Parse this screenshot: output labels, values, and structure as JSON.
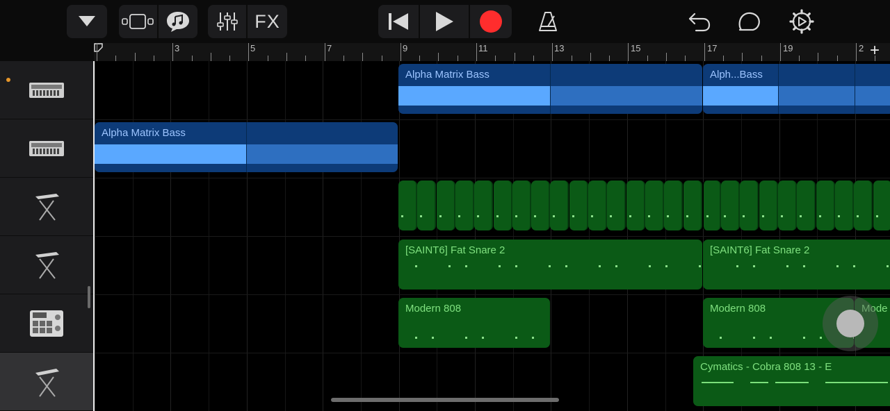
{
  "toolbar": {
    "fx_label": "FX",
    "icons": [
      "dropdown-triangle-icon",
      "tracks-view-icon",
      "live-loops-icon",
      "mixer-icon",
      "skip-back-icon",
      "play-icon",
      "record-icon",
      "metronome-icon",
      "undo-icon",
      "loop-browser-icon",
      "settings-icon"
    ],
    "record_color": "#ff2d2d"
  },
  "ruler": {
    "bar_numbers": [
      "3",
      "5",
      "7",
      "9",
      "11",
      "13",
      "15",
      "17",
      "19",
      "2"
    ],
    "add_label": "+"
  },
  "tracks": [
    {
      "instrument": "alpha-bass-synth-icon",
      "armed": true
    },
    {
      "instrument": "alpha-bass-synth-icon",
      "armed": false
    },
    {
      "instrument": "keyboard-stand-icon",
      "armed": false
    },
    {
      "instrument": "keyboard-stand-icon",
      "armed": false
    },
    {
      "instrument": "drum-machine-icon",
      "armed": false
    },
    {
      "instrument": "keyboard-stand-icon",
      "armed": false,
      "selected": true
    }
  ],
  "regions": {
    "r1": "Alpha Matrix Bass",
    "r2": "Alph...Bass",
    "r3": "Alpha Matrix Bass",
    "r4": "[SAINT6] Fat Snare 2",
    "r5": "[SAINT6] Fat Snare 2",
    "r6": "Modern 808",
    "r7": "Modern 808",
    "r8": "Mode",
    "r9": "Cymatics - Cobra 808 13 - E"
  },
  "colors": {
    "audio_region": "#0d3b78",
    "audio_wave": "#5aa8ff",
    "midi_region": "#0b5a16",
    "midi_notes": "#7fe07f"
  }
}
